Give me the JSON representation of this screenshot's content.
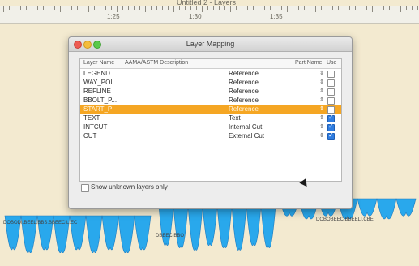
{
  "canvas": {
    "top_title": "Untitled 2 - Layers",
    "ruler_labels": [
      "1:25",
      "1:30",
      "1:35"
    ],
    "wave_labels": [
      "DOBODI.BEEL.BBS.BBEECIL.EC",
      "DBEEC.BBO",
      "DOBOBEEC.BBEELI.CBE"
    ]
  },
  "dialog": {
    "title": "Layer Mapping",
    "columns": [
      "Layer Name",
      "AAMA/ASTM Description",
      "Part Name",
      "Use"
    ],
    "rows": [
      {
        "name": "LEGEND",
        "type": "Reference",
        "use": false,
        "selected": false
      },
      {
        "name": "WAY_POI...",
        "type": "Reference",
        "use": false,
        "selected": false
      },
      {
        "name": "REFLINE",
        "type": "Reference",
        "use": false,
        "selected": false
      },
      {
        "name": "BBOLT_P...",
        "type": "Reference",
        "use": false,
        "selected": false
      },
      {
        "name": "START_P",
        "type": "Reference",
        "use": false,
        "selected": true
      },
      {
        "name": "TEXT",
        "type": "Text",
        "use": true,
        "selected": false
      },
      {
        "name": "INTCUT",
        "type": "Internal Cut",
        "use": true,
        "selected": false
      },
      {
        "name": "CUT",
        "type": "External Cut",
        "use": true,
        "selected": false
      }
    ],
    "footer_label": "Show unknown layers only",
    "footer_checked": false
  },
  "colors": {
    "selection": "#f5a623",
    "wave_fill": "#29a8ec",
    "background": "#f3ead0"
  }
}
